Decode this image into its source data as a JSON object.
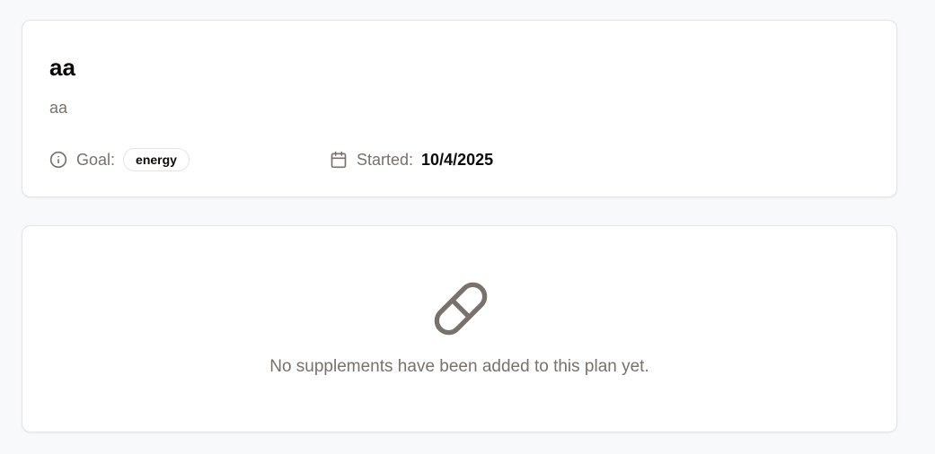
{
  "plan": {
    "title": "aa",
    "description": "aa",
    "goal_label": "Goal:",
    "goal_value": "energy",
    "started_label": "Started:",
    "started_value": "10/4/2025"
  },
  "empty_state": {
    "message": "No supplements have been added to this plan yet.",
    "icon": "pill-icon"
  },
  "icons": {
    "goal": "info-icon",
    "started": "calendar-icon"
  },
  "colors": {
    "muted_text": "#78716c",
    "strong_text": "#0c0a09",
    "border": "#e6e4e2",
    "background": "#f8f9fa"
  }
}
